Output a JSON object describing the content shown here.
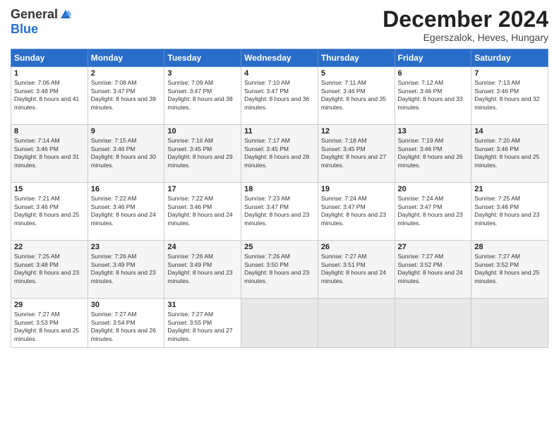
{
  "logo": {
    "general": "General",
    "blue": "Blue"
  },
  "header": {
    "month": "December 2024",
    "location": "Egerszalok, Heves, Hungary"
  },
  "days": [
    "Sunday",
    "Monday",
    "Tuesday",
    "Wednesday",
    "Thursday",
    "Friday",
    "Saturday"
  ],
  "weeks": [
    [
      {
        "day": "1",
        "sunrise": "Sunrise: 7:06 AM",
        "sunset": "Sunset: 3:48 PM",
        "daylight": "Daylight: 8 hours and 41 minutes."
      },
      {
        "day": "2",
        "sunrise": "Sunrise: 7:08 AM",
        "sunset": "Sunset: 3:47 PM",
        "daylight": "Daylight: 8 hours and 39 minutes."
      },
      {
        "day": "3",
        "sunrise": "Sunrise: 7:09 AM",
        "sunset": "Sunset: 3:47 PM",
        "daylight": "Daylight: 8 hours and 38 minutes."
      },
      {
        "day": "4",
        "sunrise": "Sunrise: 7:10 AM",
        "sunset": "Sunset: 3:47 PM",
        "daylight": "Daylight: 8 hours and 36 minutes."
      },
      {
        "day": "5",
        "sunrise": "Sunrise: 7:11 AM",
        "sunset": "Sunset: 3:46 PM",
        "daylight": "Daylight: 8 hours and 35 minutes."
      },
      {
        "day": "6",
        "sunrise": "Sunrise: 7:12 AM",
        "sunset": "Sunset: 3:46 PM",
        "daylight": "Daylight: 8 hours and 33 minutes."
      },
      {
        "day": "7",
        "sunrise": "Sunrise: 7:13 AM",
        "sunset": "Sunset: 3:46 PM",
        "daylight": "Daylight: 8 hours and 32 minutes."
      }
    ],
    [
      {
        "day": "8",
        "sunrise": "Sunrise: 7:14 AM",
        "sunset": "Sunset: 3:46 PM",
        "daylight": "Daylight: 8 hours and 31 minutes."
      },
      {
        "day": "9",
        "sunrise": "Sunrise: 7:15 AM",
        "sunset": "Sunset: 3:46 PM",
        "daylight": "Daylight: 8 hours and 30 minutes."
      },
      {
        "day": "10",
        "sunrise": "Sunrise: 7:16 AM",
        "sunset": "Sunset: 3:45 PM",
        "daylight": "Daylight: 8 hours and 29 minutes."
      },
      {
        "day": "11",
        "sunrise": "Sunrise: 7:17 AM",
        "sunset": "Sunset: 3:45 PM",
        "daylight": "Daylight: 8 hours and 28 minutes."
      },
      {
        "day": "12",
        "sunrise": "Sunrise: 7:18 AM",
        "sunset": "Sunset: 3:45 PM",
        "daylight": "Daylight: 8 hours and 27 minutes."
      },
      {
        "day": "13",
        "sunrise": "Sunrise: 7:19 AM",
        "sunset": "Sunset: 3:46 PM",
        "daylight": "Daylight: 8 hours and 26 minutes."
      },
      {
        "day": "14",
        "sunrise": "Sunrise: 7:20 AM",
        "sunset": "Sunset: 3:46 PM",
        "daylight": "Daylight: 8 hours and 25 minutes."
      }
    ],
    [
      {
        "day": "15",
        "sunrise": "Sunrise: 7:21 AM",
        "sunset": "Sunset: 3:46 PM",
        "daylight": "Daylight: 8 hours and 25 minutes."
      },
      {
        "day": "16",
        "sunrise": "Sunrise: 7:22 AM",
        "sunset": "Sunset: 3:46 PM",
        "daylight": "Daylight: 8 hours and 24 minutes."
      },
      {
        "day": "17",
        "sunrise": "Sunrise: 7:22 AM",
        "sunset": "Sunset: 3:46 PM",
        "daylight": "Daylight: 8 hours and 24 minutes."
      },
      {
        "day": "18",
        "sunrise": "Sunrise: 7:23 AM",
        "sunset": "Sunset: 3:47 PM",
        "daylight": "Daylight: 8 hours and 23 minutes."
      },
      {
        "day": "19",
        "sunrise": "Sunrise: 7:24 AM",
        "sunset": "Sunset: 3:47 PM",
        "daylight": "Daylight: 8 hours and 23 minutes."
      },
      {
        "day": "20",
        "sunrise": "Sunrise: 7:24 AM",
        "sunset": "Sunset: 3:47 PM",
        "daylight": "Daylight: 8 hours and 23 minutes."
      },
      {
        "day": "21",
        "sunrise": "Sunrise: 7:25 AM",
        "sunset": "Sunset: 3:48 PM",
        "daylight": "Daylight: 8 hours and 23 minutes."
      }
    ],
    [
      {
        "day": "22",
        "sunrise": "Sunrise: 7:25 AM",
        "sunset": "Sunset: 3:48 PM",
        "daylight": "Daylight: 8 hours and 23 minutes."
      },
      {
        "day": "23",
        "sunrise": "Sunrise: 7:26 AM",
        "sunset": "Sunset: 3:49 PM",
        "daylight": "Daylight: 8 hours and 23 minutes."
      },
      {
        "day": "24",
        "sunrise": "Sunrise: 7:26 AM",
        "sunset": "Sunset: 3:49 PM",
        "daylight": "Daylight: 8 hours and 23 minutes."
      },
      {
        "day": "25",
        "sunrise": "Sunrise: 7:26 AM",
        "sunset": "Sunset: 3:50 PM",
        "daylight": "Daylight: 8 hours and 23 minutes."
      },
      {
        "day": "26",
        "sunrise": "Sunrise: 7:27 AM",
        "sunset": "Sunset: 3:51 PM",
        "daylight": "Daylight: 8 hours and 24 minutes."
      },
      {
        "day": "27",
        "sunrise": "Sunrise: 7:27 AM",
        "sunset": "Sunset: 3:52 PM",
        "daylight": "Daylight: 8 hours and 24 minutes."
      },
      {
        "day": "28",
        "sunrise": "Sunrise: 7:27 AM",
        "sunset": "Sunset: 3:52 PM",
        "daylight": "Daylight: 8 hours and 25 minutes."
      }
    ],
    [
      {
        "day": "29",
        "sunrise": "Sunrise: 7:27 AM",
        "sunset": "Sunset: 3:53 PM",
        "daylight": "Daylight: 8 hours and 25 minutes."
      },
      {
        "day": "30",
        "sunrise": "Sunrise: 7:27 AM",
        "sunset": "Sunset: 3:54 PM",
        "daylight": "Daylight: 8 hours and 26 minutes."
      },
      {
        "day": "31",
        "sunrise": "Sunrise: 7:27 AM",
        "sunset": "Sunset: 3:55 PM",
        "daylight": "Daylight: 8 hours and 27 minutes."
      },
      null,
      null,
      null,
      null
    ]
  ]
}
